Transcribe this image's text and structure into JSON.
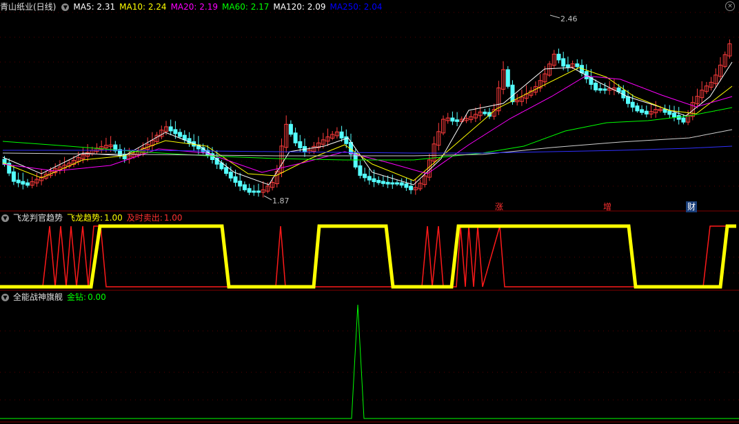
{
  "main": {
    "stock_name": "青山纸业(日线)",
    "ma": [
      {
        "label": "MA5:",
        "value": "2.31",
        "color": "#ffffff"
      },
      {
        "label": "MA10:",
        "value": "2.24",
        "color": "#ffff00"
      },
      {
        "label": "MA20:",
        "value": "2.19",
        "color": "#ff00ff"
      },
      {
        "label": "MA60:",
        "value": "2.17",
        "color": "#00ff00"
      },
      {
        "label": "MA120:",
        "value": "2.09",
        "color": "#ffffff"
      },
      {
        "label": "MA250:",
        "value": "2.04",
        "color": "#0000ff"
      }
    ],
    "high_label": "2.46",
    "low_label": "1.87",
    "tags": [
      {
        "text": "涨",
        "color": "#ff3030"
      },
      {
        "text": "增",
        "color": "#ff3030"
      },
      {
        "text": "财",
        "color": "#4fa8ff"
      }
    ]
  },
  "panel2": {
    "title": "飞龙判官趋势",
    "line1_label": "飞龙趋势:",
    "line1_value": "1.00",
    "line2_label": "及时卖出:",
    "line2_value": "1.00"
  },
  "panel3": {
    "title": "全能战神旗舰",
    "line_label": "金钻:",
    "line_value": "0.00"
  },
  "chart_data": [
    {
      "type": "candlestick",
      "title": "青山纸业(日线)",
      "high_marker": 2.46,
      "low_marker": 1.87,
      "ma_latest": {
        "MA5": 2.31,
        "MA10": 2.24,
        "MA20": 2.19,
        "MA60": 2.17,
        "MA120": 2.09,
        "MA250": 2.04
      },
      "ylim": [
        1.78,
        2.5
      ]
    },
    {
      "type": "line",
      "series": [
        {
          "name": "飞龙趋势",
          "latest": 1.0
        },
        {
          "name": "及时卖出",
          "latest": 1.0
        }
      ],
      "ylim": [
        0,
        1
      ]
    },
    {
      "type": "line",
      "series": [
        {
          "name": "金钻",
          "latest": 0.0
        }
      ],
      "ylim": [
        0,
        1
      ]
    }
  ]
}
